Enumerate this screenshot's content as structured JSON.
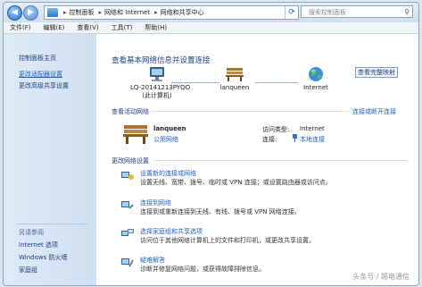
{
  "address": {
    "crumbs": [
      "控制面板",
      "网络和 Internet",
      "网络和共享中心"
    ],
    "search_placeholder": "搜索控制面板"
  },
  "menu": [
    "文件(F)",
    "编辑(E)",
    "查看(V)",
    "工具(T)",
    "帮助(H)"
  ],
  "sidebar": {
    "links": [
      "控制面板主页",
      "更改适配器设置",
      "更改高级共享设置"
    ],
    "see_also_header": "另请参阅",
    "see_also": [
      "Internet 选项",
      "Windows 防火墙",
      "家庭组"
    ]
  },
  "main": {
    "title": "查看基本网络信息并设置连接",
    "full_map": "查看完整映射",
    "nodes": {
      "computer_name": "LQ-20141213PYQO",
      "computer_sub": "(此计算机)",
      "network": "lanqueen",
      "internet": "Internet"
    },
    "active_header": "查看活动网络",
    "connect_disconnect": "连接或断开连接",
    "active_network": {
      "name": "lanqueen",
      "type": "公用网络",
      "access_label": "访问类型:",
      "access_value": "Internet",
      "connection_label": "连接:",
      "connection_value": "本地连接"
    },
    "change_header": "更改网络设置",
    "tasks": [
      {
        "title": "设置新的连接或网络",
        "desc": "设置无线、宽带、拨号、临时或 VPN 连接；或设置路由器或访问点。"
      },
      {
        "title": "连接到网络",
        "desc": "连接到或重新连接到无线、有线、拨号或 VPN 网络连接。"
      },
      {
        "title": "选择家庭组和共享选项",
        "desc": "访问位于其他网络计算机上的文件和打印机，或更改共享设置。"
      },
      {
        "title": "疑难解答",
        "desc": "诊断并修复网络问题，或获得故障排除信息。"
      }
    ]
  },
  "watermark": "头条号 / 踢电通信"
}
